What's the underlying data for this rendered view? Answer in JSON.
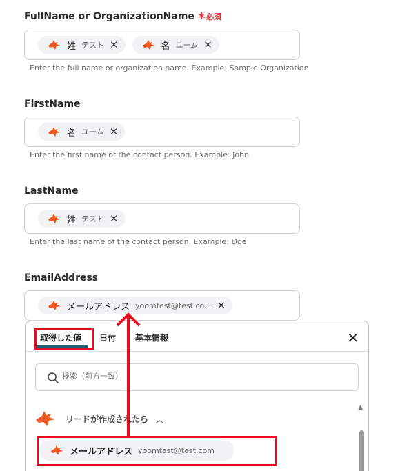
{
  "fields": [
    {
      "label": "FullName or OrganizationName",
      "required_mark": "＊",
      "required_text": "必須",
      "chips": [
        {
          "icon": "fox-icon",
          "name": "姓",
          "value": "テスト"
        },
        {
          "icon": "fox-icon",
          "name": "名",
          "value": "ユーム"
        }
      ],
      "help": "Enter the full name or organization name. Example: Sample Organization"
    },
    {
      "label": "FirstName",
      "chips": [
        {
          "icon": "fox-icon",
          "name": "名",
          "value": "ユーム"
        }
      ],
      "help": "Enter the first name of the contact person. Example: John"
    },
    {
      "label": "LastName",
      "chips": [
        {
          "icon": "fox-icon",
          "name": "姓",
          "value": "テスト"
        }
      ],
      "help": "Enter the last name of the contact person. Example: Doe"
    },
    {
      "label": "EmailAddress",
      "chips": [
        {
          "icon": "fox-icon",
          "name": "メールアドレス",
          "value": "yoomtest@test.co..."
        }
      ]
    }
  ],
  "panel": {
    "tabs": [
      "取得した値",
      "日付",
      "基本情報"
    ],
    "active_tab": "取得した値",
    "search_placeholder": "検索（前方一致）",
    "group_label": "リードが作成されたら",
    "group_chevron": "^",
    "option": {
      "icon": "fox-icon",
      "name": "メールアドレス",
      "value": "yoomtest@test.com"
    }
  },
  "icons": {
    "close": "close-icon",
    "search": "search-icon",
    "chevron": "chevron-up-icon"
  },
  "colors": {
    "accent_red": "#e30d1b",
    "tab_underline": "#1b5f78",
    "fox_orange": "#f05a22"
  }
}
